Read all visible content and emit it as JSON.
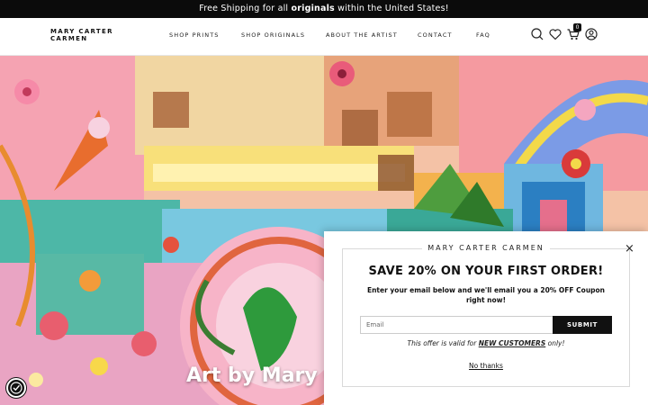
{
  "announcement": {
    "prefix": "Free Shipping for all ",
    "emphasis": "originals",
    "suffix": " within the United States!"
  },
  "header": {
    "logo_line1": "MARY CARTER",
    "logo_line2": "CARMEN",
    "nav": [
      "SHOP PRINTS",
      "SHOP ORIGINALS",
      "ABOUT THE ARTIST",
      "CONTACT",
      "FAQ"
    ],
    "cart_count": "0",
    "icons": [
      "search-icon",
      "heart-icon",
      "cart-icon",
      "account-icon"
    ]
  },
  "hero": {
    "title": "Art by Mary C"
  },
  "popup": {
    "brand": "MARY CARTER CARMEN",
    "close_label": "×",
    "title": "SAVE 20% ON YOUR FIRST ORDER!",
    "description": "Enter your email below and we'll email you a 20% OFF Coupon right now!",
    "email_placeholder": "Email",
    "submit_label": "SUBMIT",
    "offer_prefix": "This offer is valid for ",
    "offer_emphasis": "NEW CUSTOMERS",
    "offer_suffix": " only!",
    "dismiss_label": "No thanks"
  },
  "colors": {
    "announcement_bg": "#0b0b0b",
    "button_bg": "#111111"
  }
}
